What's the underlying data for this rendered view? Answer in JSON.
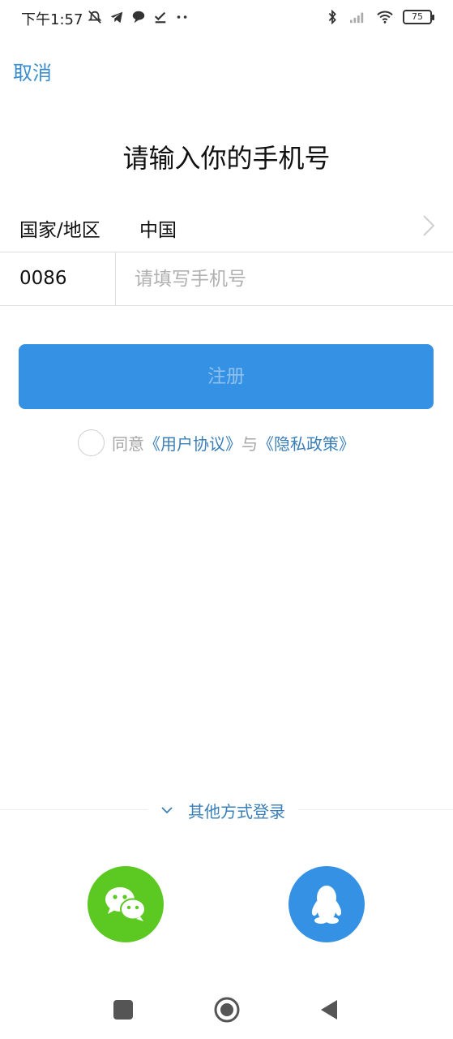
{
  "status_bar": {
    "time": "下午1:57",
    "battery": "75",
    "left_icons": [
      "mute-bell-icon",
      "telegram-icon",
      "chat-bubble-icon",
      "checkmark-icon",
      "more-dots-icon"
    ],
    "right_icons": [
      "bluetooth-icon",
      "signal-icon",
      "wifi-icon",
      "battery-icon"
    ]
  },
  "header": {
    "cancel_label": "取消"
  },
  "title": "请输入你的手机号",
  "country_row": {
    "label": "国家/地区",
    "value": "中国"
  },
  "phone_row": {
    "country_code": "0086",
    "placeholder": "请填写手机号",
    "value": ""
  },
  "register_button": {
    "label": "注册"
  },
  "agreement": {
    "prefix": "同意",
    "user_agreement": "《用户协议》",
    "joiner": "与",
    "privacy_policy": "《隐私政策》",
    "checked": false
  },
  "other_login": {
    "label": "其他方式登录",
    "options": [
      "wechat-icon",
      "qq-icon"
    ]
  },
  "colors": {
    "accent": "#3591e4",
    "link": "#3b7fb8",
    "wechat": "#5cc923"
  }
}
